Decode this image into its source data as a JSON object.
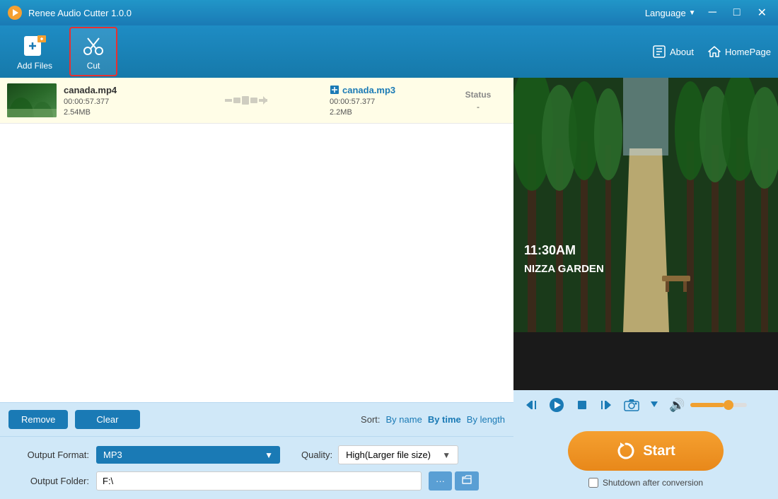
{
  "titlebar": {
    "app_name": "Renee Audio Cutter 1.0.0",
    "language_label": "Language",
    "min_btn": "─",
    "max_btn": "□",
    "close_btn": "✕"
  },
  "toolbar": {
    "add_files_label": "Add Files",
    "cut_label": "Cut",
    "about_label": "About",
    "homepage_label": "HomePage"
  },
  "file_list": {
    "rows": [
      {
        "input_name": "canada.mp4",
        "input_duration": "00:00:57.377",
        "input_size": "2.54MB",
        "output_name": "canada.mp3",
        "output_duration": "00:00:57.377",
        "output_size": "2.2MB",
        "status_label": "Status",
        "status_value": "-"
      }
    ]
  },
  "controls": {
    "remove_label": "Remove",
    "clear_label": "Clear",
    "sort_label": "Sort:",
    "sort_by_name": "By name",
    "sort_by_time": "By time",
    "sort_by_length": "By length"
  },
  "output_settings": {
    "format_label": "Output Format:",
    "format_value": "MP3",
    "quality_label": "Quality:",
    "quality_value": "High(Larger file size)",
    "folder_label": "Output Folder:",
    "folder_value": "F:\\"
  },
  "player": {
    "skip_back_icon": "⏮",
    "play_icon": "▶",
    "stop_icon": "■",
    "skip_forward_icon": "⏭",
    "camera_icon": "📷",
    "volume_icon": "🔊",
    "volume_pct": 60
  },
  "start": {
    "button_label": "Start",
    "shutdown_label": "Shutdown after conversion"
  },
  "video": {
    "overlay_line1": "11:30AM",
    "overlay_line2": "NIZZA GARDEN"
  }
}
